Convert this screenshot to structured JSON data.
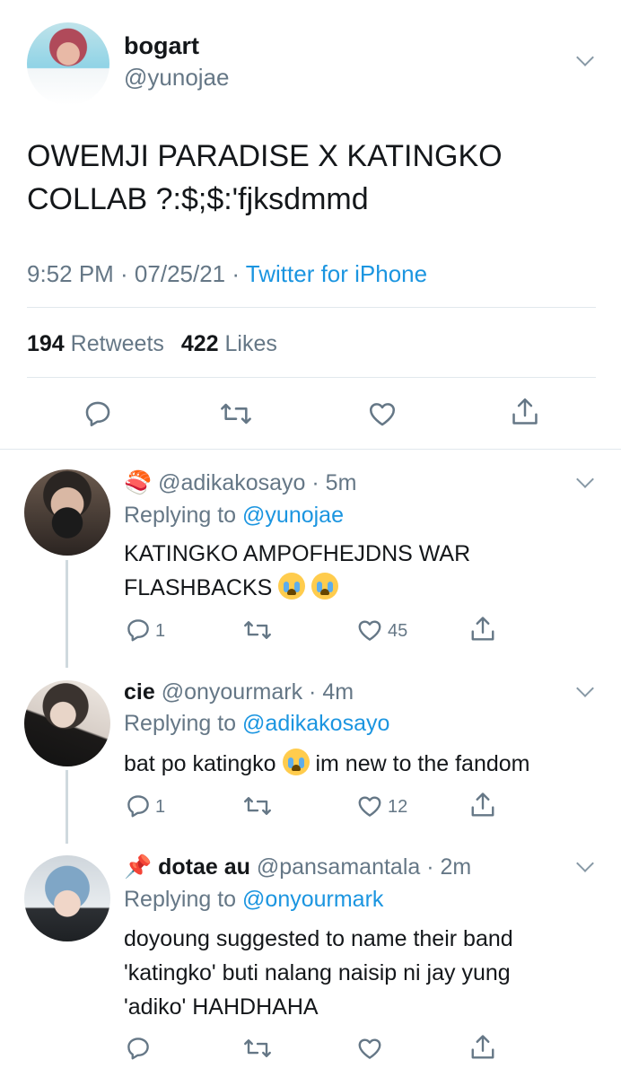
{
  "tweet": {
    "display_name": "bogart",
    "handle": "@yunojae",
    "text_line1": "OWEMJI PARADISE X KATINGKO",
    "text_line2": "COLLAB ?:$;$:'fjksdmmd",
    "time": "9:52 PM · 07/25/21 · ",
    "source": "Twitter for iPhone",
    "retweets_count": "194",
    "retweets_label": "Retweets",
    "likes_count": "422",
    "likes_label": "Likes"
  },
  "replies": [
    {
      "prefix_emoji": "🍣",
      "display_name": "",
      "handle": "@adikakosayo",
      "time": "· 5m",
      "replying_label": "Replying to",
      "replying_to": "@yunojae",
      "text_line1": "KATINGKO AMPOFHEJDNS WAR",
      "text_line2": "FLASHBACKS",
      "reply_count": "1",
      "like_count": "45"
    },
    {
      "prefix_emoji": "",
      "display_name": "cie",
      "handle": "@onyourmark",
      "time": "· 4m",
      "replying_label": "Replying to",
      "replying_to": "@adikakosayo",
      "text_before": "bat po katingko",
      "text_after": "im new to the fandom",
      "reply_count": "1",
      "like_count": "12"
    },
    {
      "prefix_emoji": "📌",
      "display_name": "dotae au",
      "handle": "@pansamantala",
      "time": "· 2m",
      "replying_label": "Replying to",
      "replying_to": "@onyourmark",
      "text_line1": "doyoung suggested to name their band",
      "text_line2": "'katingko' buti nalang naisip ni jay yung",
      "text_line3": "'adiko' HAHDHAHA"
    }
  ],
  "icons": {
    "reply": "reply-icon",
    "retweet": "retweet-icon",
    "like": "heart-icon",
    "share": "share-icon",
    "more": "chevron-down-icon"
  },
  "colors": {
    "link": "#1b95e0",
    "secondary_text": "#657786",
    "divider": "#e1e8ed"
  }
}
